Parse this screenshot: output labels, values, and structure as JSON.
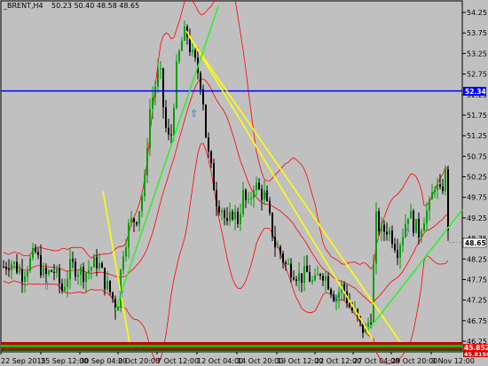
{
  "header": {
    "symbol": "_BRENT,H4",
    "ohlc": "50.23 50.40 48.58 48.65"
  },
  "colors": {
    "background": "#c0c0c0",
    "candle_up": "#00a000",
    "candle_down": "#000000",
    "bollinger": "#ff0000",
    "trendline_yellow": "#ffff00",
    "trendline_green": "#33ee33",
    "hline": "#0000ff",
    "price_tag": "#ffffff",
    "arrow_marker": "#3a5fcd"
  },
  "price_axis": {
    "labels": [
      "54.25",
      "53.75",
      "53.25",
      "52.75",
      "52.25",
      "51.75",
      "51.25",
      "50.75",
      "50.25",
      "49.75",
      "49.25",
      "48.75",
      "48.25",
      "47.75",
      "47.25",
      "46.75",
      "46.25"
    ]
  },
  "time_axis": {
    "labels": [
      "22 Sep 2015",
      "25 Sep 12:00",
      "30 Sep 04:00",
      "2 Oct 20:00",
      "7 Oct 12:00",
      "12 Oct 04:00",
      "14 Oct 20:00",
      "19 Oct 12:00",
      "22 Oct 12:00",
      "27 Oct 04:00",
      "29 Oct 20:00",
      "3 Nov 12:00"
    ]
  },
  "price_tags": {
    "hline_price": "52.34",
    "current_price": "48.65",
    "bottom_red": "45.8526",
    "bottom_red2": "45.8150"
  },
  "markers": {
    "arrow_glyph": "⇧"
  },
  "chart_data": {
    "type": "candlestick",
    "title": "_BRENT,H4",
    "ylim": [
      46.0,
      54.5
    ],
    "close_path": [
      [
        0,
        48.0
      ],
      [
        12,
        48.2
      ],
      [
        25,
        47.9
      ],
      [
        40,
        48.4
      ],
      [
        50,
        47.8
      ],
      [
        60,
        48.0
      ],
      [
        70,
        47.5
      ],
      [
        80,
        48.1
      ],
      [
        95,
        47.9
      ],
      [
        110,
        48.2
      ],
      [
        118,
        47.7
      ],
      [
        125,
        47.4
      ],
      [
        132,
        47.0
      ],
      [
        138,
        48.4
      ],
      [
        146,
        49.1
      ],
      [
        155,
        49.3
      ],
      [
        163,
        50.1
      ],
      [
        168,
        51.8
      ],
      [
        174,
        52.4
      ],
      [
        180,
        52.9
      ],
      [
        186,
        51.5
      ],
      [
        192,
        51.0
      ],
      [
        198,
        52.7
      ],
      [
        204,
        53.5
      ],
      [
        210,
        53.8
      ],
      [
        216,
        53.2
      ],
      [
        222,
        52.9
      ],
      [
        228,
        52.4
      ],
      [
        233,
        51.0
      ],
      [
        238,
        50.4
      ],
      [
        244,
        49.7
      ],
      [
        250,
        49.5
      ],
      [
        256,
        49.0
      ],
      [
        262,
        49.4
      ],
      [
        268,
        49.2
      ],
      [
        274,
        49.8
      ],
      [
        280,
        49.5
      ],
      [
        286,
        50.1
      ],
      [
        292,
        49.9
      ],
      [
        298,
        49.8
      ],
      [
        304,
        49.2
      ],
      [
        310,
        48.6
      ],
      [
        316,
        48.4
      ],
      [
        322,
        48.1
      ],
      [
        330,
        48.0
      ],
      [
        338,
        47.8
      ],
      [
        346,
        47.9
      ],
      [
        354,
        47.6
      ],
      [
        362,
        48.0
      ],
      [
        370,
        47.7
      ],
      [
        378,
        47.3
      ],
      [
        386,
        47.6
      ],
      [
        394,
        47.1
      ],
      [
        400,
        46.9
      ],
      [
        406,
        46.6
      ],
      [
        412,
        46.5
      ],
      [
        418,
        46.9
      ],
      [
        424,
        49.2
      ],
      [
        430,
        48.9
      ],
      [
        436,
        49.0
      ],
      [
        442,
        48.8
      ],
      [
        448,
        48.5
      ],
      [
        454,
        48.9
      ],
      [
        460,
        49.4
      ],
      [
        466,
        49.1
      ],
      [
        472,
        48.9
      ],
      [
        478,
        49.3
      ],
      [
        484,
        49.5
      ],
      [
        490,
        50.1
      ],
      [
        496,
        49.8
      ],
      [
        502,
        50.3
      ],
      [
        506,
        48.65
      ]
    ],
    "yellow_trendlines": [
      {
        "from_price": 49.9,
        "to_price": 46.2
      },
      {
        "from_price": 53.8,
        "to_price": 46.3
      },
      {
        "from_price": 53.7,
        "to_price": 46.2
      }
    ],
    "green_trendlines": [
      {
        "from_price": 47.0,
        "to_price": 54.4
      },
      {
        "from_price": 46.6,
        "to_price": 49.45
      }
    ],
    "horizontal_line": 52.34,
    "last_price": 48.65
  }
}
